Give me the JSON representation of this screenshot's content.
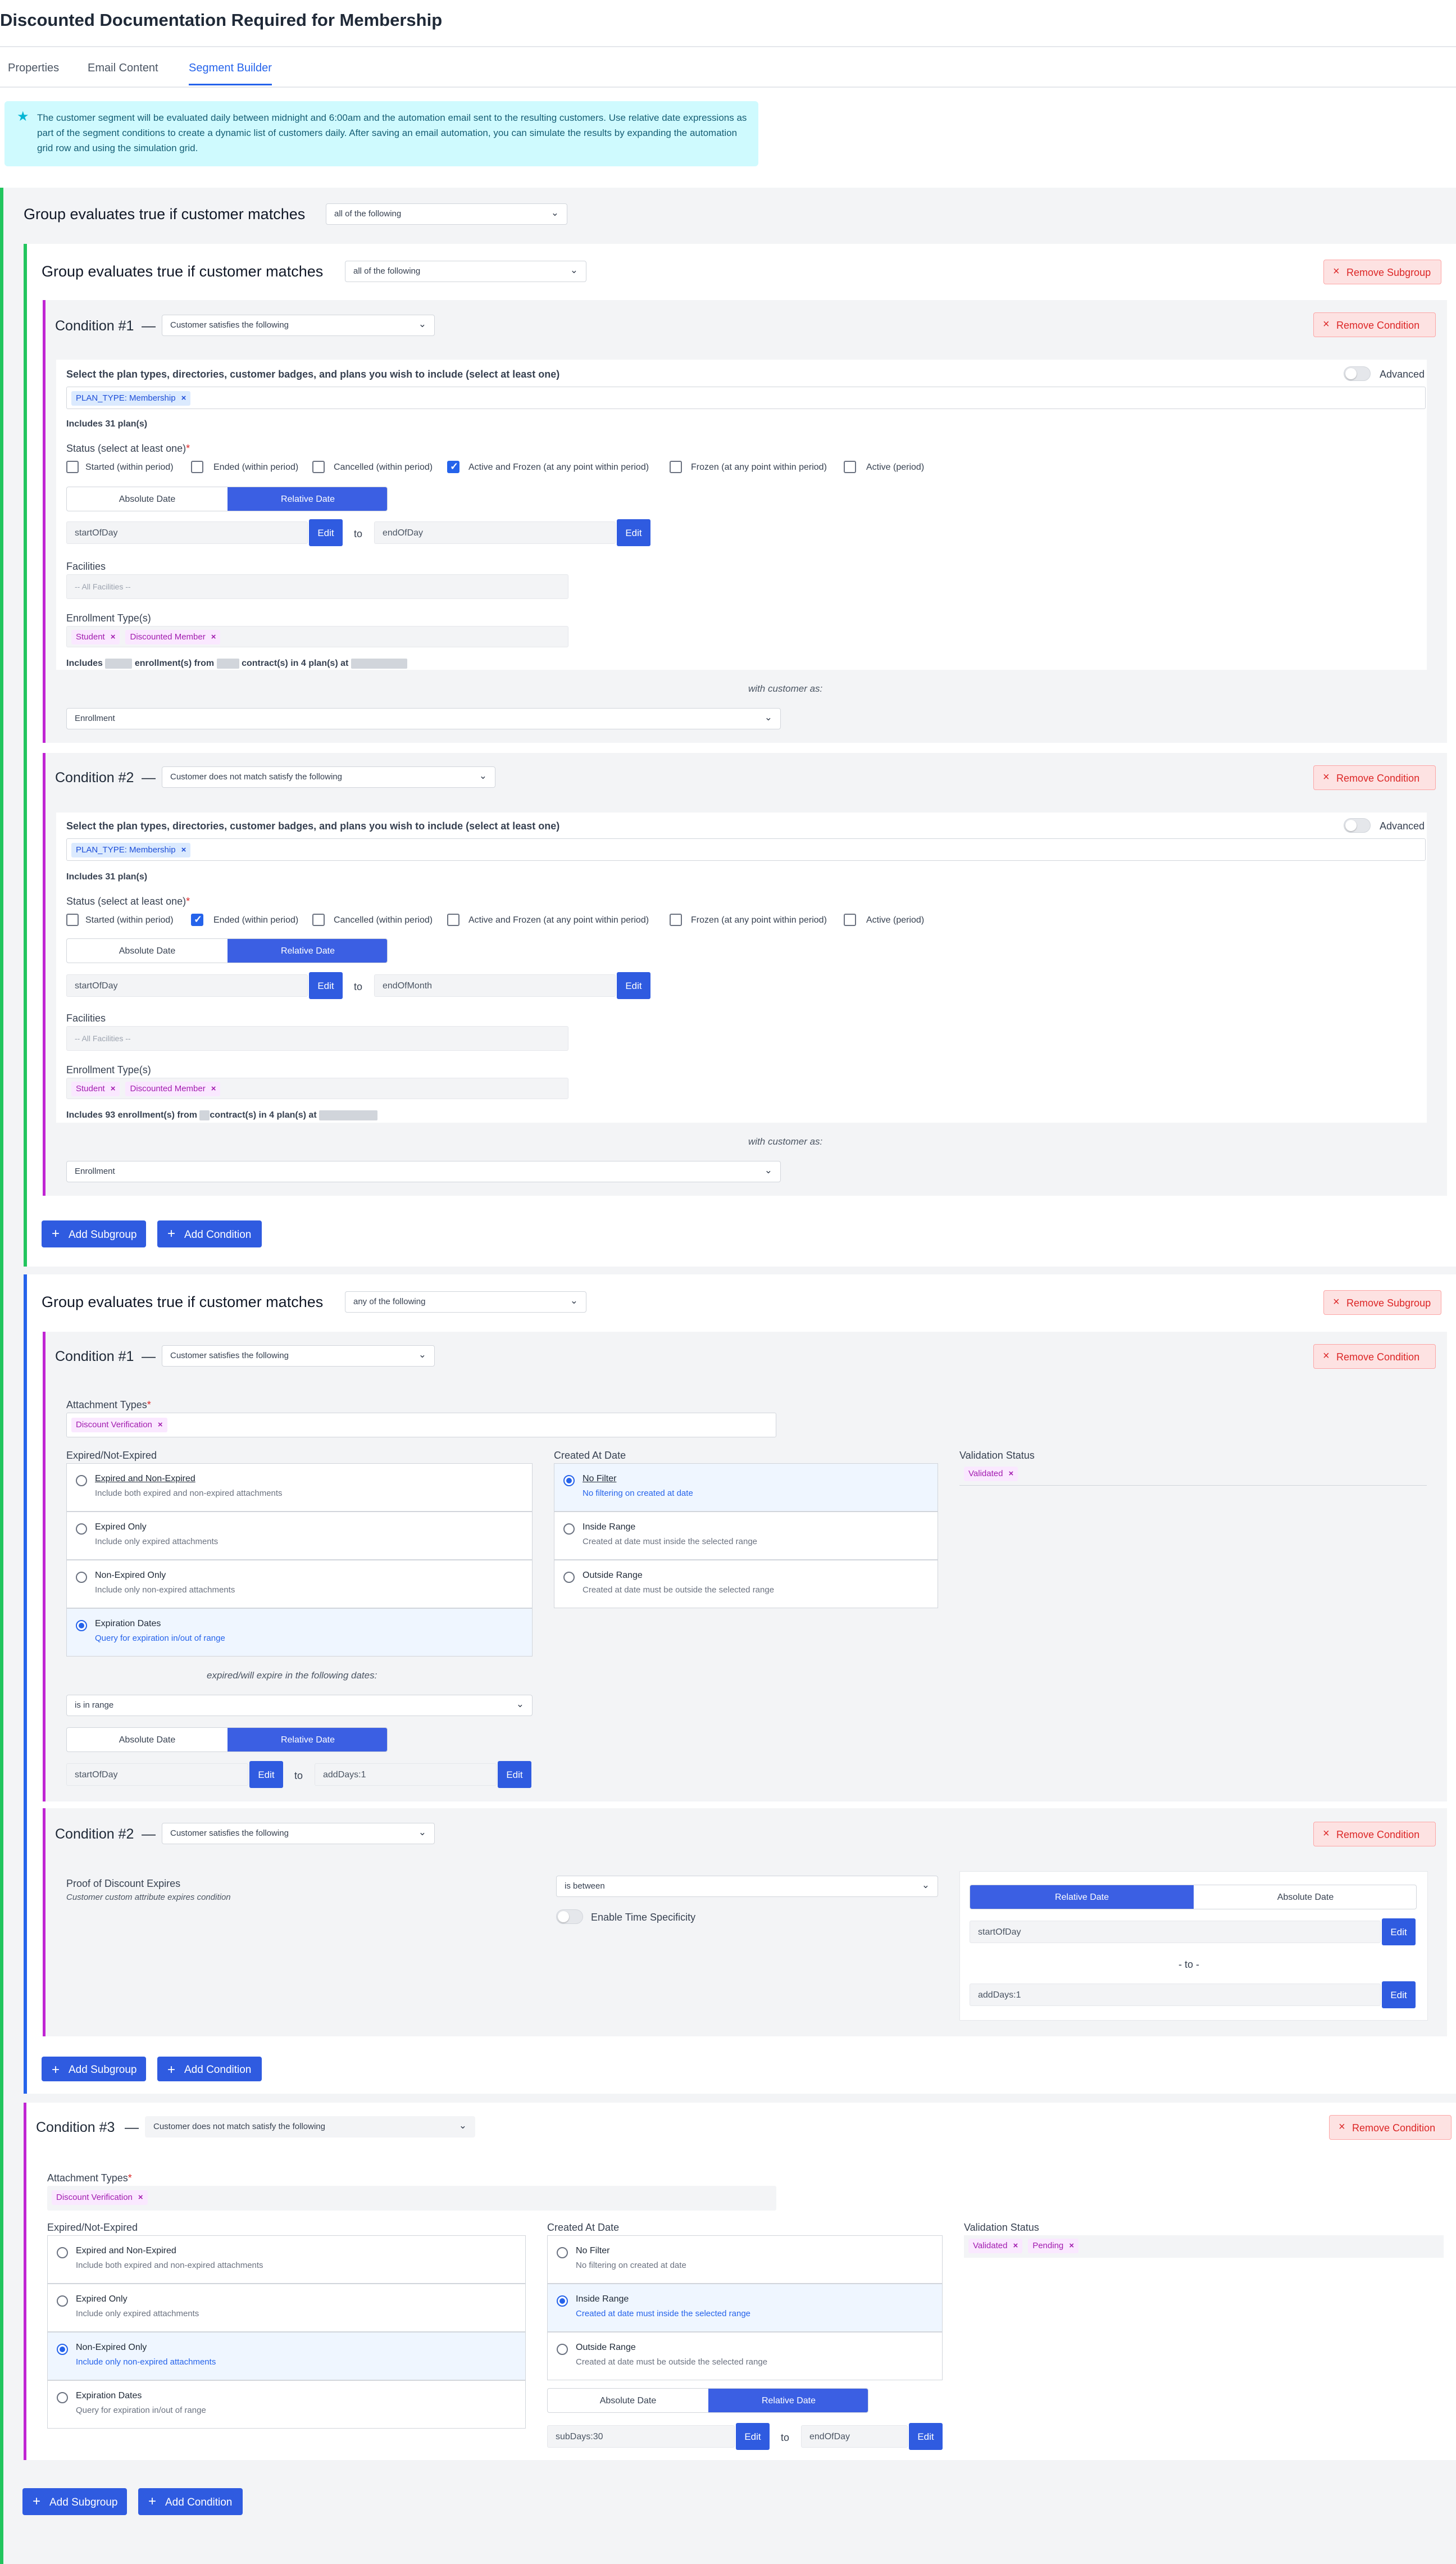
{
  "page": {
    "title": "Discounted Documentation Required for Membership"
  },
  "tabs": [
    "Properties",
    "Email Content",
    "Segment Builder"
  ],
  "info": "The customer segment will be evaluated daily between midnight and 6:00am and the automation email sent to the resulting customers. Use relative date expressions as part of the segment conditions to create a dynamic list of customers daily. After saving an email automation, you can simulate the results by expanding the automation grid row and using the simulation grid.",
  "common": {
    "group_label": "Group evaluates true if customer matches",
    "all": "all of the following",
    "any": "any of the following",
    "remove_subgroup": "Remove Subgroup",
    "remove_condition": "Remove Condition",
    "satisfies": "Customer satisfies the following",
    "not_satisfy": "Customer does not match satisfy the following",
    "dash": "—",
    "select_plans": "Select the plan types, directories, customer badges, and plans you wish to include (select at least one)",
    "advanced": "Advanced",
    "plan_tag": "PLAN_TYPE: Membership",
    "includes_plans": "Includes 31 plan(s)",
    "status_label": "Status (select at least one)",
    "req": "*",
    "statuses": [
      "Started (within period)",
      "Ended (within period)",
      "Cancelled (within period)",
      "Active and Frozen (at any point within period)",
      "Frozen (at any point within period)",
      "Active (period)"
    ],
    "absolute": "Absolute Date",
    "relative": "Relative Date",
    "edit": "Edit",
    "to": "to",
    "to_dash": "- to -",
    "facilities": "Facilities",
    "all_facilities": "-- All Facilities --",
    "enroll_types": "Enrollment Type(s)",
    "student": "Student",
    "discounted_member": "Discounted Member",
    "with_customer": "with customer as:",
    "enrollment": "Enrollment",
    "add_subgroup": "Add Subgroup",
    "add_condition": "Add Condition",
    "attachment_types": "Attachment Types",
    "discount_verification": "Discount Verification",
    "expired_label": "Expired/Not-Expired",
    "created_label": "Created At Date",
    "validation_label": "Validation Status",
    "validated": "Validated",
    "pending": "Pending",
    "exp_opts": [
      {
        "t": "Expired and Non-Expired",
        "s": "Include both expired and non-expired attachments"
      },
      {
        "t": "Expired Only",
        "s": "Include only expired attachments"
      },
      {
        "t": "Non-Expired Only",
        "s": "Include only non-expired attachments"
      },
      {
        "t": "Expiration Dates",
        "s": "Query for expiration in/out of range"
      }
    ],
    "created_opts": [
      {
        "t": "No Filter",
        "s": "No filtering on created at date"
      },
      {
        "t": "Inside Range",
        "s": "Created at date must inside the selected range"
      },
      {
        "t": "Outside Range",
        "s": "Created at date must be outside the selected range"
      }
    ],
    "expire_dates": "expired/will expire in the following dates:",
    "is_in_range": "is in range",
    "proof_label": "Proof of Discount Expires",
    "proof_sub": "Customer custom attribute expires condition",
    "is_between": "is between",
    "time_spec": "Enable Time Specificity",
    "x": "×",
    "plus": "+",
    "chev": "⌄",
    "star": "★"
  },
  "g1c1": {
    "title": "Condition #1",
    "from": "startOfDay",
    "until": "endOfDay",
    "inc_a": "Includes",
    "inc_b": "enrollment(s) from",
    "inc_c": "contract(s) in 4 plan(s) at"
  },
  "g1c2": {
    "title": "Condition #2",
    "from": "startOfDay",
    "until": "endOfMonth",
    "inc_a": "Includes 93 enrollment(s) from",
    "inc_b": "contract(s) in 4 plan(s) at"
  },
  "g2c1": {
    "title": "Condition #1",
    "from": "startOfDay",
    "until": "addDays:1"
  },
  "g2c2": {
    "title": "Condition #2",
    "from": "startOfDay",
    "until": "addDays:1"
  },
  "c3": {
    "title": "Condition #3",
    "from": "subDays:30",
    "until": "endOfDay"
  }
}
